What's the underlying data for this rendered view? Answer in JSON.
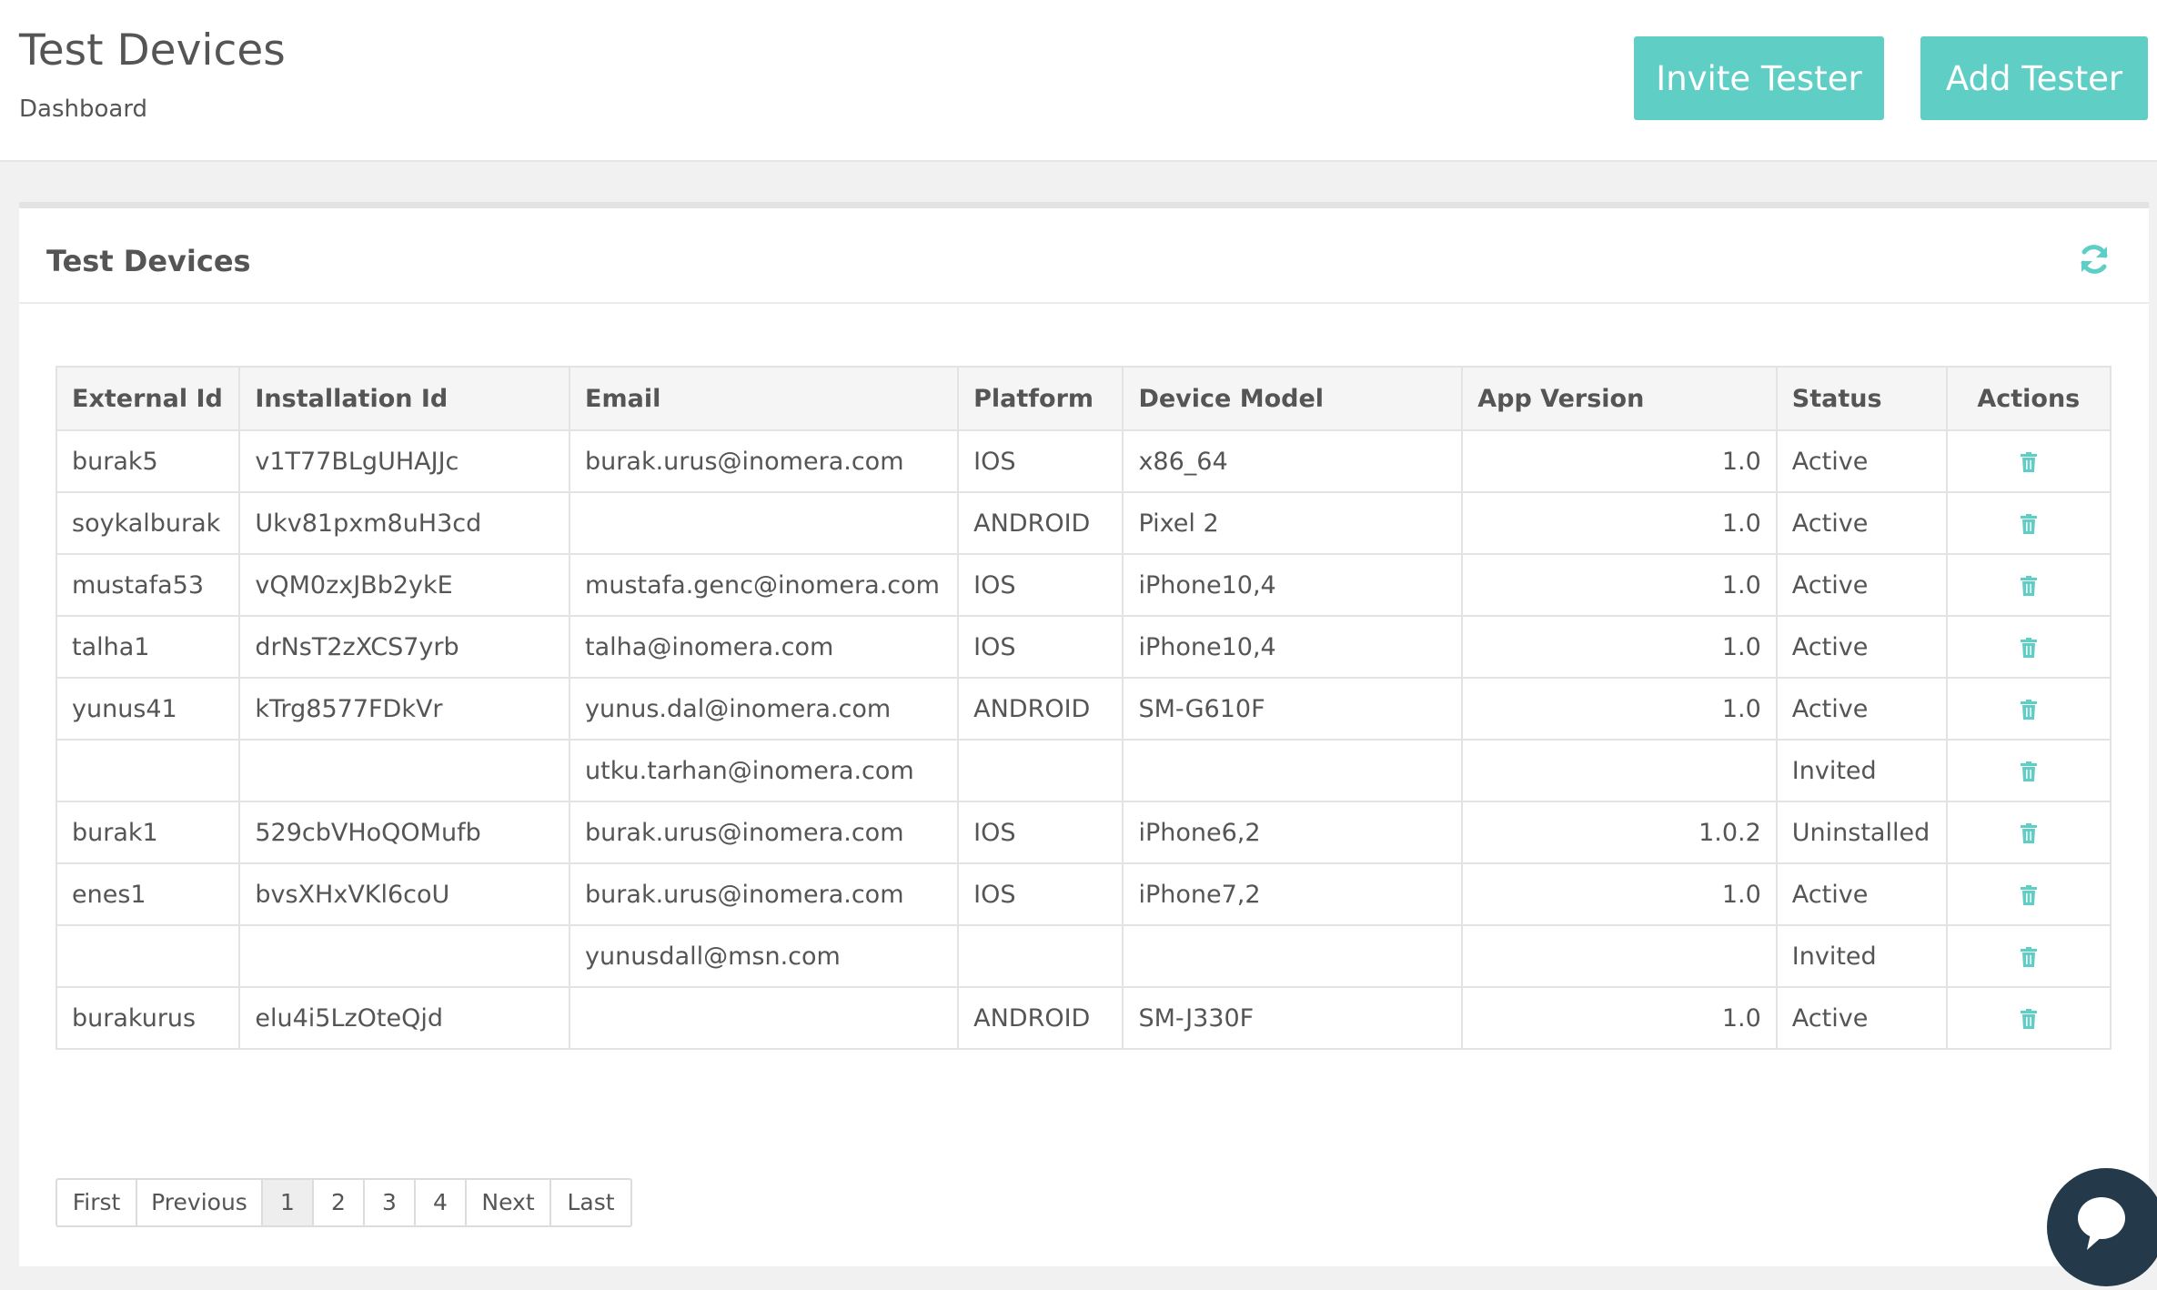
{
  "header": {
    "title": "Test Devices",
    "breadcrumb": "Dashboard",
    "invite_label": "Invite Tester",
    "add_label": "Add Tester"
  },
  "panel": {
    "title": "Test Devices",
    "refresh_icon": "refresh-icon"
  },
  "table": {
    "columns": {
      "external_id": "External Id",
      "installation_id": "Installation Id",
      "email": "Email",
      "platform": "Platform",
      "device_model": "Device Model",
      "app_version": "App Version",
      "status": "Status",
      "actions": "Actions"
    },
    "rows": [
      {
        "external_id": "burak5",
        "installation_id": "v1T77BLgUHAJJc",
        "email": "burak.urus@inomera.com",
        "platform": "IOS",
        "device_model": "x86_64",
        "app_version": "1.0",
        "status": "Active"
      },
      {
        "external_id": "soykalburak",
        "installation_id": "Ukv81pxm8uH3cd",
        "email": "",
        "platform": "ANDROID",
        "device_model": "Pixel 2",
        "app_version": "1.0",
        "status": "Active"
      },
      {
        "external_id": "mustafa53",
        "installation_id": "vQM0zxJBb2ykE",
        "email": "mustafa.genc@inomera.com",
        "platform": "IOS",
        "device_model": "iPhone10,4",
        "app_version": "1.0",
        "status": "Active"
      },
      {
        "external_id": "talha1",
        "installation_id": "drNsT2zXCS7yrb",
        "email": "talha@inomera.com",
        "platform": "IOS",
        "device_model": "iPhone10,4",
        "app_version": "1.0",
        "status": "Active"
      },
      {
        "external_id": "yunus41",
        "installation_id": "kTrg8577FDkVr",
        "email": "yunus.dal@inomera.com",
        "platform": "ANDROID",
        "device_model": "SM-G610F",
        "app_version": "1.0",
        "status": "Active"
      },
      {
        "external_id": "",
        "installation_id": "",
        "email": "utku.tarhan@inomera.com",
        "platform": "",
        "device_model": "",
        "app_version": "",
        "status": "Invited"
      },
      {
        "external_id": "burak1",
        "installation_id": "529cbVHoQOMufb",
        "email": "burak.urus@inomera.com",
        "platform": "IOS",
        "device_model": "iPhone6,2",
        "app_version": "1.0.2",
        "status": "Uninstalled"
      },
      {
        "external_id": "enes1",
        "installation_id": "bvsXHxVKl6coU",
        "email": "burak.urus@inomera.com",
        "platform": "IOS",
        "device_model": "iPhone7,2",
        "app_version": "1.0",
        "status": "Active"
      },
      {
        "external_id": "",
        "installation_id": "",
        "email": "yunusdall@msn.com",
        "platform": "",
        "device_model": "",
        "app_version": "",
        "status": "Invited"
      },
      {
        "external_id": "burakurus",
        "installation_id": "elu4i5LzOteQjd",
        "email": "",
        "platform": "ANDROID",
        "device_model": "SM-J330F",
        "app_version": "1.0",
        "status": "Active"
      }
    ],
    "action_icon": "trash-icon"
  },
  "pagination": {
    "first": "First",
    "previous": "Previous",
    "pages": [
      "1",
      "2",
      "3",
      "4"
    ],
    "current": "1",
    "next": "Next",
    "last": "Last"
  },
  "colors": {
    "accent": "#5fcfc6",
    "chat": "#243a4a"
  },
  "chat_icon": "chat-icon"
}
